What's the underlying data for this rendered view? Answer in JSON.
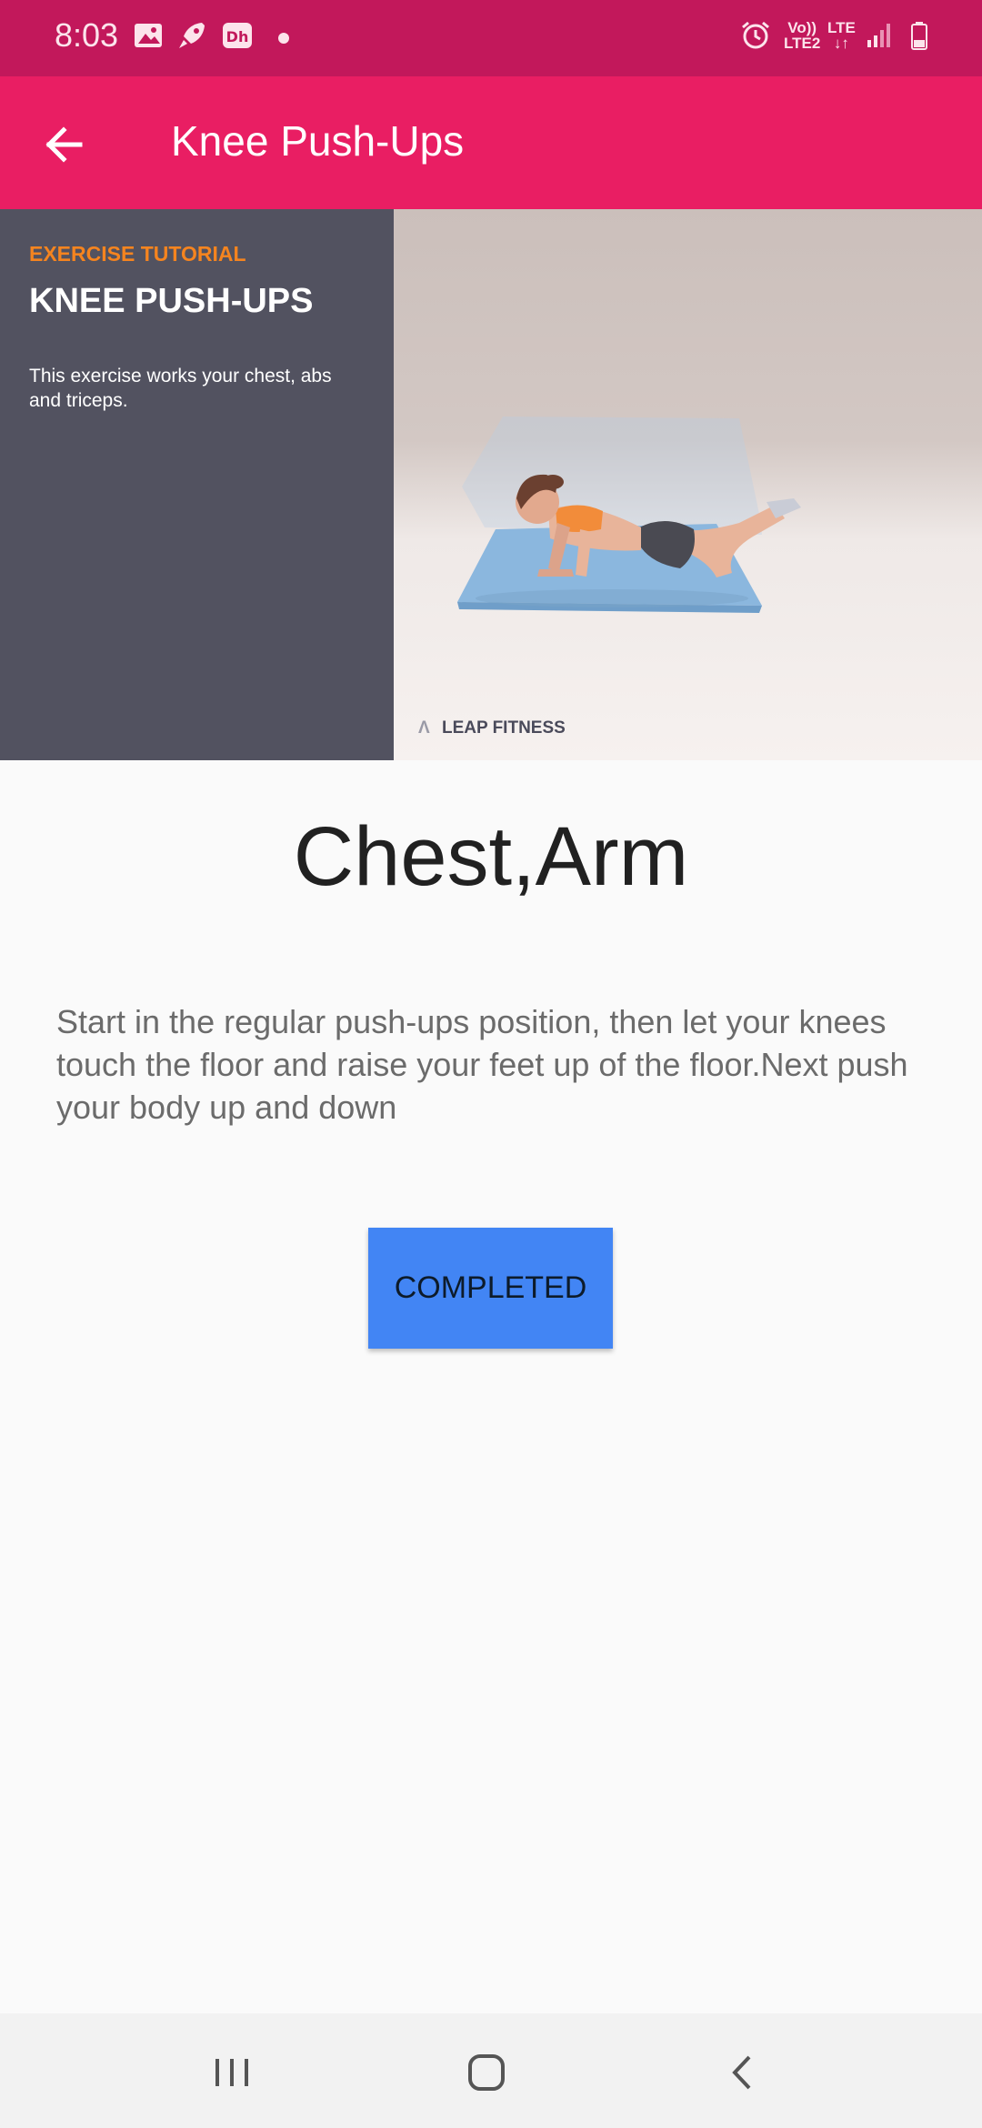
{
  "status_bar": {
    "time": "8:03",
    "network_top": "Vo))",
    "network_bottom": "LTE2",
    "lte_label": "LTE",
    "icons": [
      "gallery-icon",
      "rocket-icon",
      "disney-hotstar-icon",
      "notification-dot",
      "alarm-icon",
      "volte-icon",
      "lte-data-icon",
      "signal-icon",
      "battery-icon"
    ]
  },
  "app_bar": {
    "title": "Knee Push-Ups",
    "back_icon": "arrow-left-icon"
  },
  "hero": {
    "eyebrow": "EXERCISE TUTORIAL",
    "title": "KNEE PUSH-UPS",
    "description": "This exercise works your chest, abs and triceps.",
    "brand": "LEAP FITNESS"
  },
  "exercise": {
    "muscles": "Chest,Arm",
    "description": "Start in the regular push-ups position, then let your knees touch the floor and raise your feet up of the floor.Next push your body up and down",
    "completed_label": "COMPLETED"
  },
  "nav_bar": {
    "recents": "recents-icon",
    "home": "home-icon",
    "back": "back-chevron-icon"
  },
  "colors": {
    "status_bar": "#c2185b",
    "app_bar": "#e91e63",
    "button": "#4285f4",
    "hero_panel": "#525260",
    "eyebrow": "#f5841f"
  }
}
